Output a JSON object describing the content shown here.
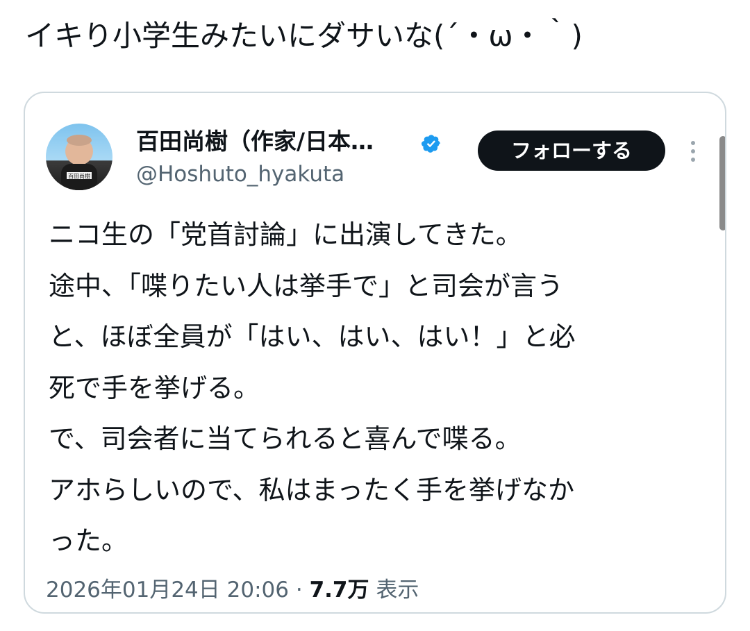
{
  "reply": {
    "text": "イキり小学生みたいにダサいな(´・ω・｀)"
  },
  "quoted_tweet": {
    "author": {
      "display_name": "百田尚樹（作家/日本…",
      "handle": "@Hoshuto_hyakuta",
      "avatar_caption": "百田尚樹",
      "verified_icon": "verified-badge-icon"
    },
    "follow_label": "フォローする",
    "more_icon": "more-vertical-icon",
    "body_lines": [
      "ニコ生の「党首討論」に出演してきた。",
      "途中、「喋りたい人は挙手で」と司会が言う",
      "と、ほぼ全員が「はい、はい、はい！」と必",
      "死で手を挙げる。",
      "で、司会者に当てられると喜んで喋る。",
      "アホらしいので、私はまったく手を挙げなか",
      "った。"
    ],
    "timestamp": "2026年01月24日 20:06",
    "separator": "·",
    "views_count": "7.7万",
    "views_label": "表示"
  },
  "colors": {
    "text_primary": "#0f1419",
    "text_secondary": "#536471",
    "border": "#cfd9de",
    "verified": "#1d9bf0",
    "button_bg": "#0f1419",
    "button_text": "#ffffff"
  }
}
